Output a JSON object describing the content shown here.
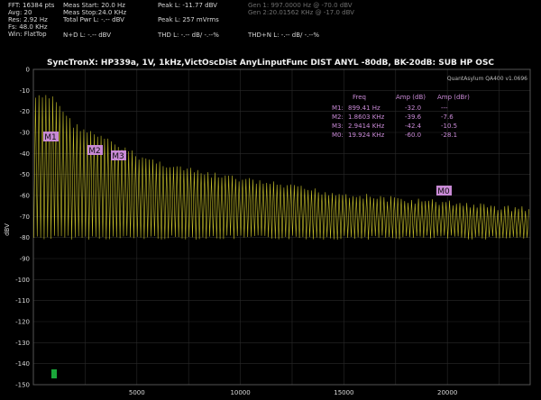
{
  "header": {
    "col1": [
      "FFT: 16384 pts",
      "Avg: 20",
      "Res: 2.92 Hz",
      "Fs: 48.0 KHz",
      "Win: FlatTop"
    ],
    "col2": [
      "Meas Start: 20.0 Hz",
      "Meas Stop:24.0 KHz",
      "Total Pwr L: -.-- dBV"
    ],
    "nd": "N+D L: -.-- dBV",
    "peak_dbv": "Peak L: -11.77 dBV",
    "peak_mv": "Peak L: 257 mVrms",
    "thd": "THD L: -.-- dB/ -.--%",
    "gen": [
      "Gen 1: 997.0000 Hz @ -70.0  dBV",
      "Gen 2:20.01562 KHz @ -17.0  dBV"
    ],
    "thdn": "THD+N L: -.-- dB/ -.--%"
  },
  "colors": {
    "trace": "#c7c02a",
    "marker": "#c98ad6",
    "grid": "#2a2a2a",
    "background": "#000000",
    "indicator": "#1aa83a"
  },
  "chart_data": {
    "type": "line",
    "title": "SyncTronX: HP339a, 1V, 1kHz,VictOscDist AnyLinputFunc DIST ANYL -80dB, BK-20dB: SUB HP OSC",
    "watermark": "QuantAsylum QA400 v1.0696",
    "ylabel": "dBV",
    "xlim": [
      0,
      24000
    ],
    "ylim": [
      -150,
      0
    ],
    "y_ticks": [
      "0",
      "-10",
      "-20",
      "-30",
      "-40",
      "-50",
      "-60",
      "-70",
      "-80",
      "-90",
      "-100",
      "-110",
      "-120",
      "-130",
      "-140",
      "-150"
    ],
    "x_ticks": [
      "5000",
      "10000",
      "15000",
      "20000"
    ],
    "x_tick_values": [
      5000,
      10000,
      15000,
      20000
    ],
    "grid": true,
    "series": [
      {
        "fundamental_hz": 899.41,
        "envelope_peaks": [
          [
            899,
            -12
          ],
          [
            1860,
            -25
          ],
          [
            2941,
            -30
          ],
          [
            4000,
            -35
          ],
          [
            5000,
            -40
          ],
          [
            6000,
            -43
          ],
          [
            8000,
            -48
          ],
          [
            10000,
            -51
          ],
          [
            12000,
            -54
          ],
          [
            14000,
            -57
          ],
          [
            16000,
            -59
          ],
          [
            18000,
            -61
          ],
          [
            20000,
            -62
          ],
          [
            22000,
            -64
          ],
          [
            24000,
            -65
          ]
        ],
        "noise_floor": [
          [
            0,
            -78
          ],
          [
            24000,
            -78
          ]
        ]
      }
    ],
    "markers": [
      {
        "label": "M1",
        "freq_hz": 899.41,
        "amp_db": -32.0
      },
      {
        "label": "M2",
        "freq_hz": 1860.3,
        "amp_db": -39.6
      },
      {
        "label": "M3",
        "freq_hz": 2941.4,
        "amp_db": -42.4
      },
      {
        "label": "M0",
        "freq_hz": 19924,
        "amp_db": -60.0
      }
    ],
    "marker_table": {
      "headers": [
        "Freq",
        "Amp (dB)",
        "Amp (dBr)"
      ],
      "rows": [
        [
          "M1:",
          "899.41 Hz",
          "-32.0",
          "---"
        ],
        [
          "M2:",
          "1.8603 KHz",
          "-39.6",
          "-7.6"
        ],
        [
          "M3:",
          "2.9414 KHz",
          "-42.4",
          "-10.5"
        ],
        [
          "M0:",
          "19.924 KHz",
          "-60.0",
          "-28.1"
        ]
      ]
    }
  }
}
